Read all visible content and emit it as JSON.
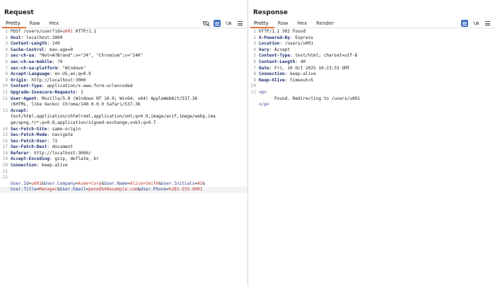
{
  "request": {
    "title": "Request",
    "tabs": [
      "Pretty",
      "Raw",
      "Hex"
    ],
    "lines": [
      {
        "n": "1",
        "parts": [
          {
            "t": "POST /users/user?id=",
            "c": "hv"
          },
          {
            "t": "u001",
            "c": "pu"
          },
          {
            "t": " HTTP/1.1",
            "c": "hv"
          }
        ]
      },
      {
        "n": "2",
        "parts": [
          {
            "t": "Host",
            "c": "hn"
          },
          {
            "t": ": localhost:3000",
            "c": "hv"
          }
        ]
      },
      {
        "n": "3",
        "parts": [
          {
            "t": "Content-Length",
            "c": "hn"
          },
          {
            "t": ": 149",
            "c": "hv"
          }
        ]
      },
      {
        "n": "4",
        "parts": [
          {
            "t": "Cache-Control",
            "c": "hn"
          },
          {
            "t": ": max-age=0",
            "c": "hv"
          }
        ]
      },
      {
        "n": "5",
        "parts": [
          {
            "t": "sec-ch-ua",
            "c": "hn"
          },
          {
            "t": ": \"Not=A?Brand\";v=\"24\", \"Chromium\";v=\"140\"",
            "c": "hv"
          }
        ]
      },
      {
        "n": "6",
        "parts": [
          {
            "t": "sec-ch-ua-mobile",
            "c": "hn"
          },
          {
            "t": ": ?0",
            "c": "hv"
          }
        ]
      },
      {
        "n": "7",
        "parts": [
          {
            "t": "sec-ch-ua-platform",
            "c": "hn"
          },
          {
            "t": ": \"Windows\"",
            "c": "hv"
          }
        ]
      },
      {
        "n": "8",
        "parts": [
          {
            "t": "Accept-Language",
            "c": "hn"
          },
          {
            "t": ": en-US,en;q=0.9",
            "c": "hv"
          }
        ]
      },
      {
        "n": "9",
        "parts": [
          {
            "t": "Origin",
            "c": "hn"
          },
          {
            "t": ": http://localhost:3000",
            "c": "hv"
          }
        ]
      },
      {
        "n": "10",
        "parts": [
          {
            "t": "Content-Type",
            "c": "hn"
          },
          {
            "t": ": application/x-www-form-urlencoded",
            "c": "hv"
          }
        ]
      },
      {
        "n": "11",
        "parts": [
          {
            "t": "Upgrade-Insecure-Requests",
            "c": "hn"
          },
          {
            "t": ": 1",
            "c": "hv"
          }
        ]
      },
      {
        "n": "12",
        "parts": [
          {
            "t": "User-Agent",
            "c": "hn"
          },
          {
            "t": ": Mozilla/5.0 (Windows NT 10.0; Win64; x64) AppleWebKit/537.36",
            "c": "hv"
          }
        ]
      },
      {
        "n": "",
        "parts": [
          {
            "t": "(KHTML, like Gecko) Chrome/140.0.0.0 Safari/537.36",
            "c": "hv"
          }
        ]
      },
      {
        "n": "13",
        "parts": [
          {
            "t": "Accept",
            "c": "hn"
          },
          {
            "t": ":",
            "c": "hv"
          }
        ]
      },
      {
        "n": "",
        "parts": [
          {
            "t": "text/html,application/xhtml+xml,application/xml;q=0.9,image/avif,image/webp,ima",
            "c": "hv"
          }
        ]
      },
      {
        "n": "",
        "parts": [
          {
            "t": "ge/apng,*/*;q=0.8,application/signed-exchange;v=b3;q=0.7",
            "c": "hv"
          }
        ]
      },
      {
        "n": "14",
        "parts": [
          {
            "t": "Sec-Fetch-Site",
            "c": "hn"
          },
          {
            "t": ": same-origin",
            "c": "hv"
          }
        ]
      },
      {
        "n": "15",
        "parts": [
          {
            "t": "Sec-Fetch-Mode",
            "c": "hn"
          },
          {
            "t": ": navigate",
            "c": "hv"
          }
        ]
      },
      {
        "n": "16",
        "parts": [
          {
            "t": "Sec-Fetch-User",
            "c": "hn"
          },
          {
            "t": ": ?1",
            "c": "hv"
          }
        ]
      },
      {
        "n": "17",
        "parts": [
          {
            "t": "Sec-Fetch-Dest",
            "c": "hn"
          },
          {
            "t": ": document",
            "c": "hv"
          }
        ]
      },
      {
        "n": "18",
        "parts": [
          {
            "t": "Referer",
            "c": "hn"
          },
          {
            "t": ": http://localhost:3000/",
            "c": "hv"
          }
        ]
      },
      {
        "n": "19",
        "parts": [
          {
            "t": "Accept-Encoding",
            "c": "hn"
          },
          {
            "t": ": gzip, deflate, br",
            "c": "hv"
          }
        ]
      },
      {
        "n": "20",
        "parts": [
          {
            "t": "Connection",
            "c": "hn"
          },
          {
            "t": ": keep-alive",
            "c": "hv"
          }
        ]
      },
      {
        "n": "21",
        "parts": []
      },
      {
        "n": "22",
        "parts": []
      },
      {
        "n": "",
        "parts": [
          {
            "t": "User.Id",
            "c": "pk"
          },
          {
            "t": "=",
            "c": "hv"
          },
          {
            "t": "u001",
            "c": "pv"
          },
          {
            "t": "&",
            "c": "hv"
          },
          {
            "t": "User.Company",
            "c": "pk"
          },
          {
            "t": "=",
            "c": "hv"
          },
          {
            "t": "Acme+Corp",
            "c": "pv"
          },
          {
            "t": "&",
            "c": "hv"
          },
          {
            "t": "User.Name",
            "c": "pk"
          },
          {
            "t": "=",
            "c": "hv"
          },
          {
            "t": "Alice+Smith",
            "c": "pv"
          },
          {
            "t": "&",
            "c": "hv"
          },
          {
            "t": "User.Initials",
            "c": "pk"
          },
          {
            "t": "=",
            "c": "hv"
          },
          {
            "t": "AS",
            "c": "pv"
          },
          {
            "t": "&",
            "c": "hv"
          }
        ]
      },
      {
        "n": "",
        "hl": true,
        "parts": [
          {
            "t": "User.Title",
            "c": "pk"
          },
          {
            "t": "=",
            "c": "hv"
          },
          {
            "t": "Manager",
            "c": "pv"
          },
          {
            "t": "&",
            "c": "hv"
          },
          {
            "t": "User.Email",
            "c": "pk"
          },
          {
            "t": "=",
            "c": "hv"
          },
          {
            "t": "pwned%40example.com",
            "c": "pv"
          },
          {
            "t": "&",
            "c": "hv"
          },
          {
            "t": "User.Phone",
            "c": "pk"
          },
          {
            "t": "=",
            "c": "hv"
          },
          {
            "t": "%2B1-555-0001",
            "c": "pv"
          }
        ]
      }
    ]
  },
  "response": {
    "title": "Response",
    "tabs": [
      "Pretty",
      "Raw",
      "Hex",
      "Render"
    ],
    "lines": [
      {
        "n": "1",
        "parts": [
          {
            "t": "HTTP/1.1 302 Found",
            "c": "hv"
          }
        ]
      },
      {
        "n": "2",
        "parts": [
          {
            "t": "X-Powered-By",
            "c": "hn"
          },
          {
            "t": ": Express",
            "c": "hv"
          }
        ]
      },
      {
        "n": "3",
        "parts": [
          {
            "t": "Location",
            "c": "hn"
          },
          {
            "t": ": /users/u001",
            "c": "hv"
          }
        ]
      },
      {
        "n": "4",
        "parts": [
          {
            "t": "Vary",
            "c": "hn"
          },
          {
            "t": ": Accept",
            "c": "hv"
          }
        ]
      },
      {
        "n": "5",
        "parts": [
          {
            "t": "Content-Type",
            "c": "hn"
          },
          {
            "t": ": text/html; charset=utf-8",
            "c": "hv"
          }
        ]
      },
      {
        "n": "6",
        "parts": [
          {
            "t": "Content-Length",
            "c": "hn"
          },
          {
            "t": ": 40",
            "c": "hv"
          }
        ]
      },
      {
        "n": "7",
        "parts": [
          {
            "t": "Date",
            "c": "hn"
          },
          {
            "t": ": Fri, 10 Oct 2025 10:23:33 GMT",
            "c": "hv"
          }
        ]
      },
      {
        "n": "8",
        "parts": [
          {
            "t": "Connection",
            "c": "hn"
          },
          {
            "t": ": keep-alive",
            "c": "hv"
          }
        ]
      },
      {
        "n": "9",
        "parts": [
          {
            "t": "Keep-Alive",
            "c": "hn"
          },
          {
            "t": ": timeout=5",
            "c": "hv"
          }
        ]
      },
      {
        "n": "10",
        "parts": []
      },
      {
        "n": "11",
        "parts": [
          {
            "t": "<p>",
            "c": "tag"
          }
        ]
      },
      {
        "n": "",
        "parts": [
          {
            "t": "      Found. Redirecting to /users/u001",
            "c": "hv"
          }
        ]
      },
      {
        "n": "",
        "parts": [
          {
            "t": "</p>",
            "c": "tag"
          }
        ]
      }
    ]
  },
  "icons": {
    "layout_split": "layout-split-icon",
    "layout_stack": "layout-stack-icon",
    "layout_single": "layout-single-icon",
    "hide": "eye-off-icon",
    "wrap": "wrap-lines-icon",
    "newline": "\\n",
    "menu": "menu-icon"
  },
  "colors": {
    "accent": "#e8743b",
    "toggle_blue": "#3a6fbf",
    "header_name": "#1e2f6e",
    "param_value": "#c0362c"
  }
}
